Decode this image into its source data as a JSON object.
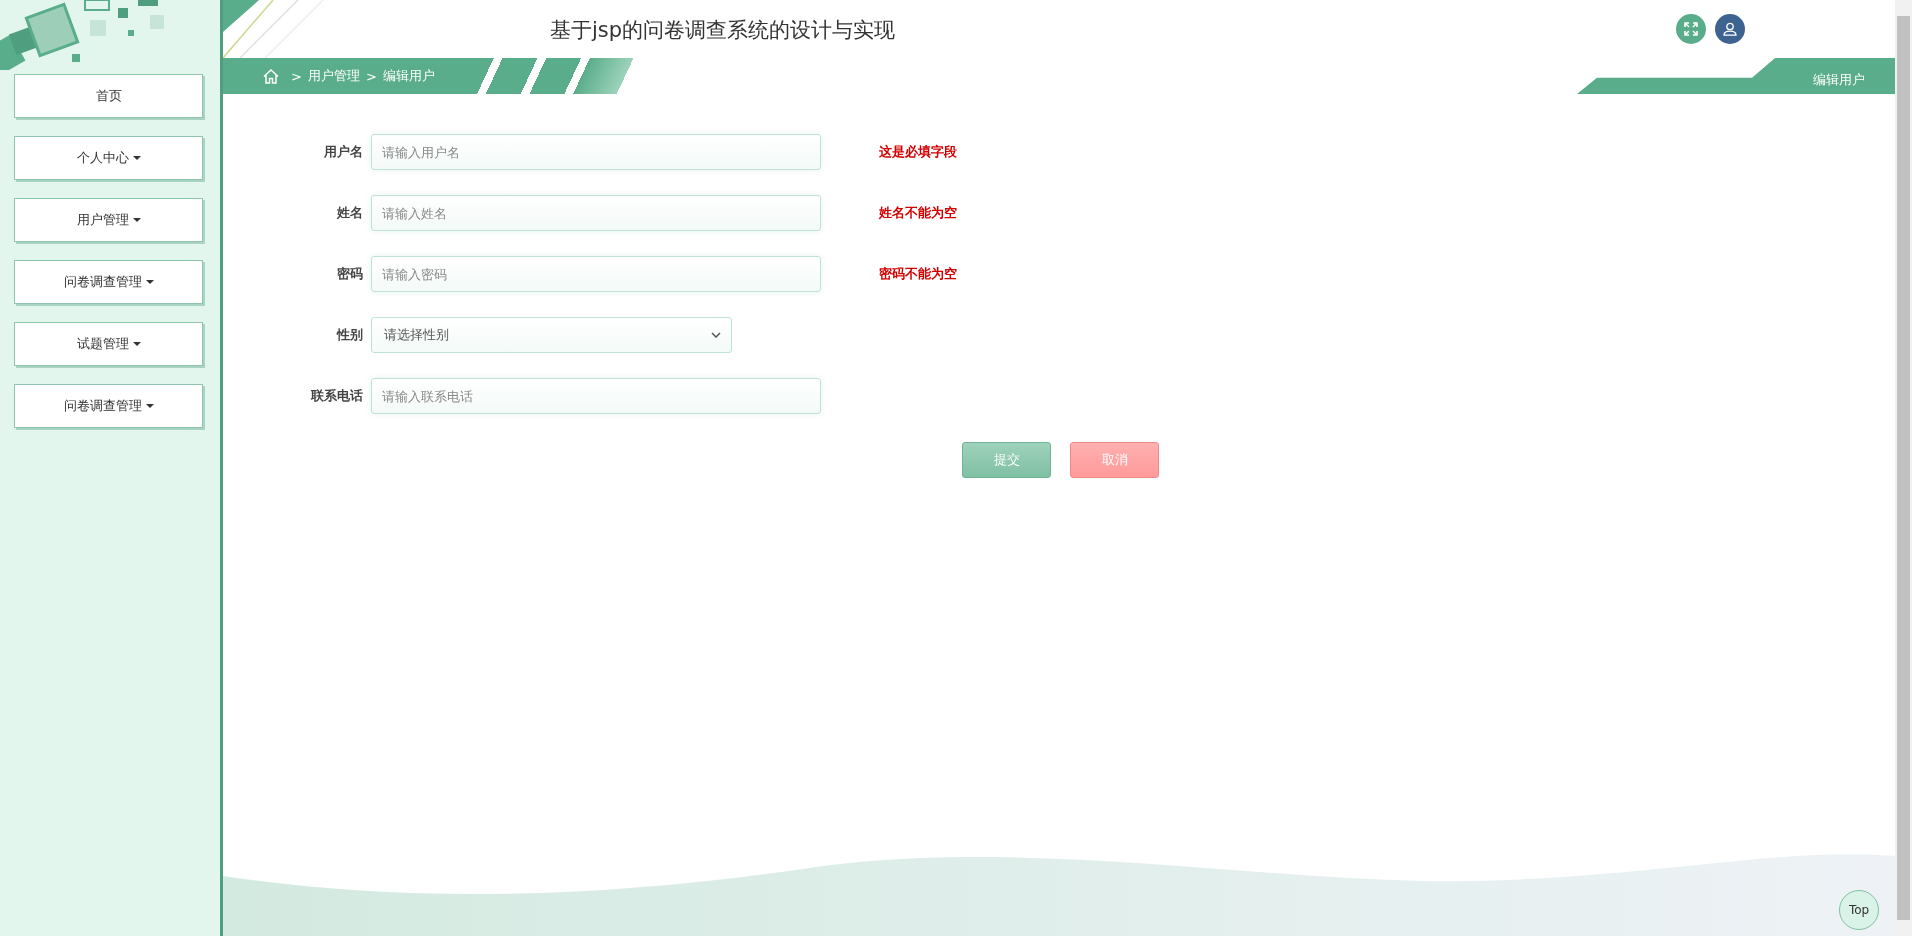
{
  "sidebar": {
    "items": [
      {
        "label": "首页",
        "has_caret": false
      },
      {
        "label": "个人中心",
        "has_caret": true
      },
      {
        "label": "用户管理",
        "has_caret": true
      },
      {
        "label": "问卷调查管理",
        "has_caret": true
      },
      {
        "label": "试题管理",
        "has_caret": true
      },
      {
        "label": "问卷调查管理",
        "has_caret": true
      }
    ]
  },
  "header": {
    "title": "基于jsp的问卷调查系统的设计与实现"
  },
  "breadcrumb": {
    "items": [
      {
        "separator": ">",
        "label": "用户管理"
      },
      {
        "separator": ">",
        "label": "编辑用户"
      }
    ],
    "page_tag": "编辑用户"
  },
  "form": {
    "fields": [
      {
        "kind": "input",
        "label": "用户名",
        "placeholder": "请输入用户名",
        "error": "这是必填字段"
      },
      {
        "kind": "input",
        "label": "姓名",
        "placeholder": "请输入姓名",
        "error": "姓名不能为空"
      },
      {
        "kind": "input",
        "label": "密码",
        "placeholder": "请输入密码",
        "error": "密码不能为空"
      },
      {
        "kind": "select",
        "label": "性别",
        "value": "请选择性别"
      },
      {
        "kind": "input",
        "label": "联系电话",
        "placeholder": "请输入联系电话"
      }
    ],
    "buttons": [
      {
        "kind": "submit",
        "label": "提交"
      },
      {
        "kind": "cancel",
        "label": "取消"
      }
    ]
  },
  "top_button": "Top"
}
